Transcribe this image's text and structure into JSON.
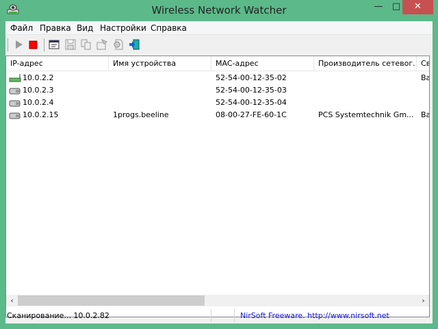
{
  "window": {
    "title": "Wireless Network Watcher",
    "minimize": "—",
    "maximize": "□",
    "close": "✕"
  },
  "menu": [
    {
      "label": "Файл"
    },
    {
      "label": "Правка"
    },
    {
      "label": "Вид"
    },
    {
      "label": "Настройки"
    },
    {
      "label": "Справка"
    }
  ],
  "toolbar": {
    "buttons": [
      "play-icon",
      "stop-icon",
      "html-report-icon",
      "save-icon",
      "copy-icon",
      "properties-icon",
      "options-icon",
      "exit-icon"
    ]
  },
  "colors": {
    "frame": "#5cb98a",
    "close": "#c75050",
    "stop": "#ff0000",
    "link": "#1515e0"
  },
  "table": {
    "columns": [
      "IP-адрес",
      "Имя устройства",
      "MAC-адрес",
      "Производитель сетевог...",
      "Сво"
    ],
    "rows": [
      {
        "icon": "router-icon",
        "cells": [
          "10.0.2.2",
          "",
          "52-54-00-12-35-02",
          "",
          "Ваш"
        ]
      },
      {
        "icon": "computer-icon",
        "cells": [
          "10.0.2.3",
          "",
          "52-54-00-12-35-03",
          "",
          ""
        ]
      },
      {
        "icon": "computer-icon",
        "cells": [
          "10.0.2.4",
          "",
          "52-54-00-12-35-04",
          "",
          ""
        ]
      },
      {
        "icon": "computer-icon",
        "cells": [
          "10.0.2.15",
          "1progs.beeline",
          "08-00-27-FE-60-1C",
          "PCS Systemtechnik Gm...",
          "Ваш"
        ]
      }
    ]
  },
  "scroll": {
    "left": "‹",
    "right": "›"
  },
  "status": {
    "scan": "Сканирование... 10.0.2.82",
    "empty": "",
    "credit": "NirSoft Freeware.  http://www.nirsoft.net"
  }
}
